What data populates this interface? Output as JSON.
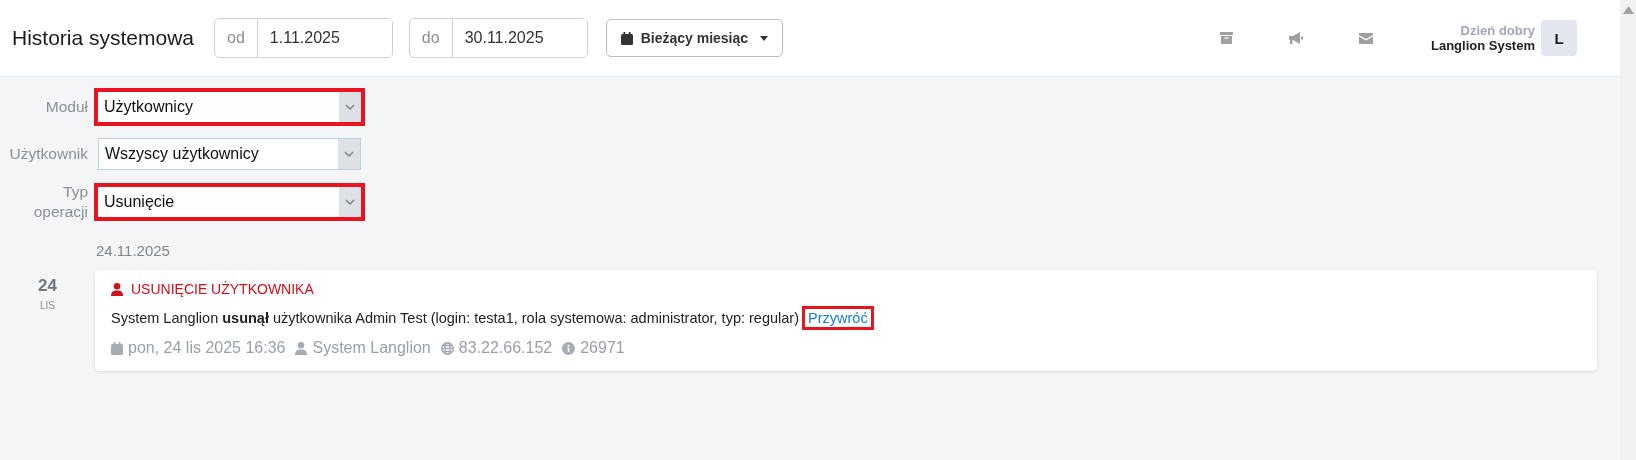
{
  "header": {
    "title": "Historia systemowa",
    "date_from": {
      "label": "od",
      "value": "1.11.2025"
    },
    "date_to": {
      "label": "do",
      "value": "30.11.2025"
    },
    "range_button": "Bieżący miesiąc",
    "greeting": "Dzień dobry",
    "user_name": "Langlion System",
    "avatar": "L"
  },
  "filters": [
    {
      "label": "Moduł",
      "value": "Użytkownicy",
      "highlighted": true
    },
    {
      "label": "Użytkownik",
      "value": "Wszyscy użytkownicy",
      "highlighted": false
    },
    {
      "label": "Typ operacji",
      "value": "Usunięcie",
      "highlighted": true
    }
  ],
  "date_heading": "24.11.2025",
  "entries": [
    {
      "day": "24",
      "month": "LIS",
      "title": "USUNIĘCIE UŻYTKOWNIKA",
      "message": "System Langlion **usunął** użytkownika Admin Test (login: testa1, rola systemowa: administrator, typ: regular)",
      "action": {
        "label": "Przywróć",
        "highlighted": true
      },
      "meta": [
        {
          "kind": "date",
          "text": "pon, 24 lis 2025 16:36"
        },
        {
          "kind": "user",
          "text": "System Langlion"
        },
        {
          "kind": "ip",
          "text": "83.22.66.152"
        },
        {
          "kind": "id",
          "text": "26971"
        }
      ]
    }
  ]
}
